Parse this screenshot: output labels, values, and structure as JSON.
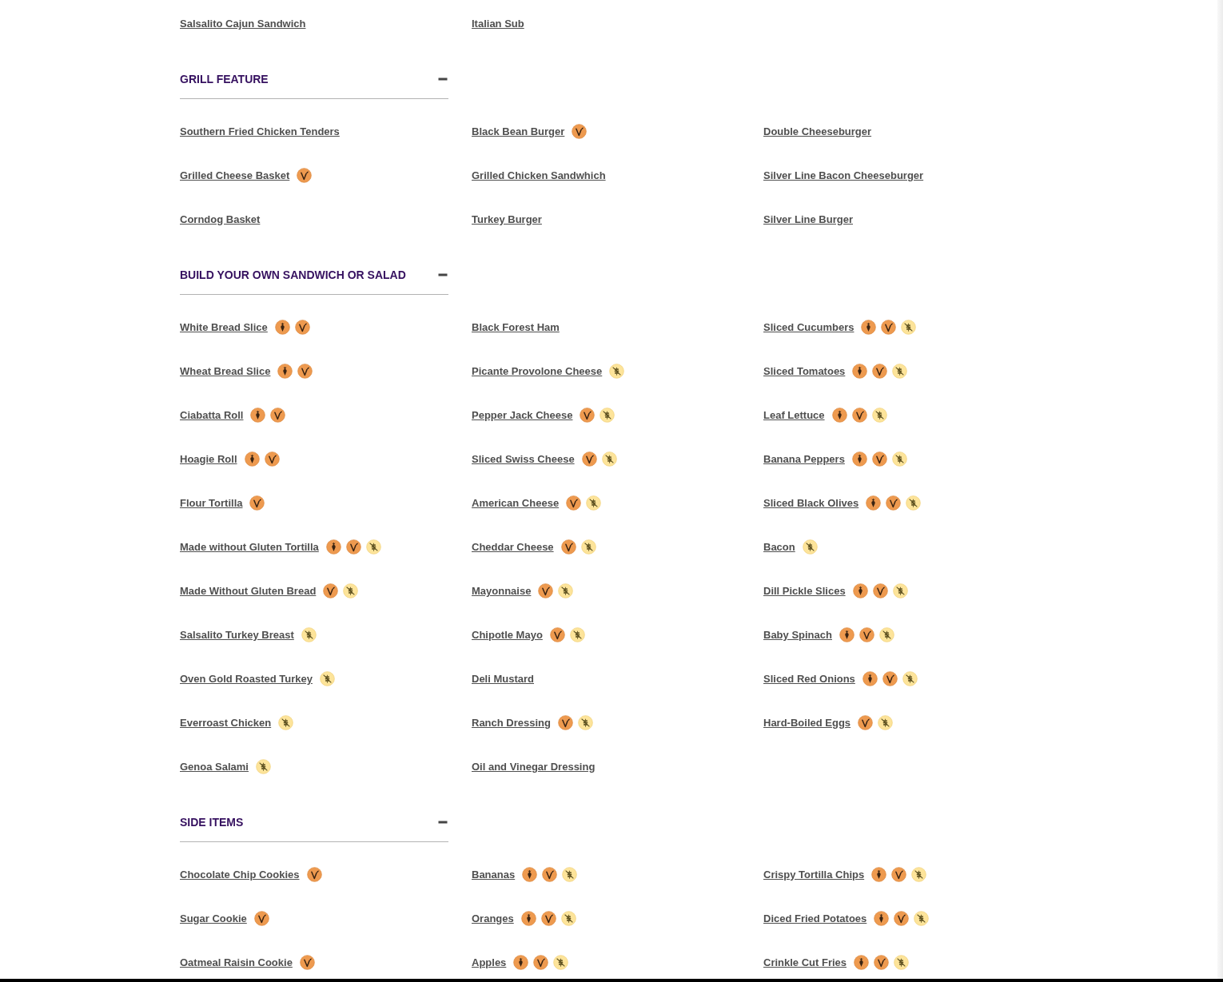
{
  "sections": [
    {
      "items": [
        {
          "name": "Salsalito Cajun Sandwich"
        },
        {
          "name": "Italian Sub"
        }
      ]
    },
    {
      "title": "GRILL FEATURE",
      "expanded": true,
      "items": [
        {
          "name": "Southern Fried Chicken Tenders"
        },
        {
          "name": "Grilled Cheese Basket",
          "icons": [
            {
              "kind": "vegetarian"
            }
          ]
        },
        {
          "name": "Corndog Basket"
        },
        {
          "name": "Black Bean Burger",
          "icons": [
            {
              "kind": "vegetarian"
            }
          ]
        },
        {
          "name": "Grilled Chicken Sandwhich"
        },
        {
          "name": "Turkey Burger"
        },
        {
          "name": "Double Cheeseburger"
        },
        {
          "name": "Silver Line Bacon Cheeseburger"
        },
        {
          "name": "Silver Line Burger"
        }
      ]
    },
    {
      "title": "BUILD YOUR OWN SANDWICH OR SALAD",
      "expanded": true,
      "items": [
        {
          "name": "White Bread Slice",
          "icons": [
            {
              "kind": "vegan"
            },
            {
              "kind": "vegetarian"
            }
          ]
        },
        {
          "name": "Wheat Bread Slice",
          "icons": [
            {
              "kind": "vegan"
            },
            {
              "kind": "vegetarian"
            }
          ]
        },
        {
          "name": "Ciabatta Roll",
          "icons": [
            {
              "kind": "vegan"
            },
            {
              "kind": "vegetarian"
            }
          ]
        },
        {
          "name": "Hoagie Roll",
          "icons": [
            {
              "kind": "vegan"
            },
            {
              "kind": "vegetarian"
            }
          ]
        },
        {
          "name": "Flour Tortilla",
          "icons": [
            {
              "kind": "vegetarian"
            }
          ]
        },
        {
          "name": "Made without Gluten Tortilla",
          "icons": [
            {
              "kind": "vegan"
            },
            {
              "kind": "vegetarian"
            },
            {
              "kind": "glutenfree"
            }
          ]
        },
        {
          "name": "Made Without Gluten Bread",
          "icons": [
            {
              "kind": "vegetarian"
            },
            {
              "kind": "glutenfree"
            }
          ]
        },
        {
          "name": "Salsalito Turkey Breast",
          "icons": [
            {
              "kind": "glutenfree"
            }
          ]
        },
        {
          "name": "Oven Gold Roasted Turkey",
          "icons": [
            {
              "kind": "glutenfree"
            }
          ]
        },
        {
          "name": "Everroast Chicken",
          "icons": [
            {
              "kind": "glutenfree"
            }
          ]
        },
        {
          "name": "Genoa Salami",
          "icons": [
            {
              "kind": "glutenfree"
            }
          ]
        },
        {
          "name": "Black Forest Ham"
        },
        {
          "name": "Picante Provolone Cheese",
          "icons": [
            {
              "kind": "glutenfree"
            }
          ]
        },
        {
          "name": "Pepper Jack Cheese",
          "icons": [
            {
              "kind": "vegetarian"
            },
            {
              "kind": "glutenfree"
            }
          ]
        },
        {
          "name": "Sliced Swiss Cheese",
          "icons": [
            {
              "kind": "vegetarian"
            },
            {
              "kind": "glutenfree"
            }
          ]
        },
        {
          "name": "American Cheese",
          "icons": [
            {
              "kind": "vegetarian"
            },
            {
              "kind": "glutenfree"
            }
          ]
        },
        {
          "name": "Cheddar Cheese",
          "icons": [
            {
              "kind": "vegetarian"
            },
            {
              "kind": "glutenfree"
            }
          ]
        },
        {
          "name": "Mayonnaise",
          "icons": [
            {
              "kind": "vegetarian"
            },
            {
              "kind": "glutenfree"
            }
          ]
        },
        {
          "name": "Chipotle Mayo",
          "icons": [
            {
              "kind": "vegetarian"
            },
            {
              "kind": "glutenfree"
            }
          ]
        },
        {
          "name": "Deli Mustard"
        },
        {
          "name": "Ranch Dressing",
          "icons": [
            {
              "kind": "vegetarian"
            },
            {
              "kind": "glutenfree"
            }
          ]
        },
        {
          "name": "Oil and Vinegar Dressing"
        },
        {
          "name": "Sliced Cucumbers",
          "icons": [
            {
              "kind": "vegan"
            },
            {
              "kind": "vegetarian"
            },
            {
              "kind": "glutenfree"
            }
          ]
        },
        {
          "name": "Sliced Tomatoes",
          "icons": [
            {
              "kind": "vegan"
            },
            {
              "kind": "vegetarian"
            },
            {
              "kind": "glutenfree"
            }
          ]
        },
        {
          "name": "Leaf Lettuce",
          "icons": [
            {
              "kind": "vegan"
            },
            {
              "kind": "vegetarian"
            },
            {
              "kind": "glutenfree"
            }
          ]
        },
        {
          "name": "Banana Peppers",
          "icons": [
            {
              "kind": "vegan"
            },
            {
              "kind": "vegetarian"
            },
            {
              "kind": "glutenfree"
            }
          ]
        },
        {
          "name": "Sliced Black Olives",
          "icons": [
            {
              "kind": "vegan"
            },
            {
              "kind": "vegetarian"
            },
            {
              "kind": "glutenfree"
            }
          ]
        },
        {
          "name": "Bacon",
          "icons": [
            {
              "kind": "glutenfree"
            }
          ]
        },
        {
          "name": "Dill Pickle Slices",
          "icons": [
            {
              "kind": "vegan"
            },
            {
              "kind": "vegetarian"
            },
            {
              "kind": "glutenfree"
            }
          ]
        },
        {
          "name": "Baby Spinach",
          "icons": [
            {
              "kind": "vegan"
            },
            {
              "kind": "vegetarian"
            },
            {
              "kind": "glutenfree"
            }
          ]
        },
        {
          "name": "Sliced Red Onions",
          "icons": [
            {
              "kind": "vegan"
            },
            {
              "kind": "vegetarian"
            },
            {
              "kind": "glutenfree"
            }
          ]
        },
        {
          "name": "Hard-Boiled Eggs",
          "icons": [
            {
              "kind": "vegetarian"
            },
            {
              "kind": "glutenfree"
            }
          ]
        }
      ]
    },
    {
      "title": "SIDE ITEMS",
      "expanded": true,
      "items": [
        {
          "name": "Chocolate Chip Cookies",
          "icons": [
            {
              "kind": "vegetarian"
            }
          ]
        },
        {
          "name": "Sugar Cookie",
          "icons": [
            {
              "kind": "vegetarian"
            }
          ]
        },
        {
          "name": "Oatmeal Raisin Cookie",
          "icons": [
            {
              "kind": "vegetarian"
            }
          ]
        },
        {
          "name": "Bananas",
          "icons": [
            {
              "kind": "vegan"
            },
            {
              "kind": "vegetarian"
            },
            {
              "kind": "glutenfree"
            }
          ]
        },
        {
          "name": "Oranges",
          "icons": [
            {
              "kind": "vegan"
            },
            {
              "kind": "vegetarian"
            },
            {
              "kind": "glutenfree"
            }
          ]
        },
        {
          "name": "Apples",
          "icons": [
            {
              "kind": "vegan"
            },
            {
              "kind": "vegetarian"
            },
            {
              "kind": "glutenfree"
            }
          ]
        },
        {
          "name": "Crispy Tortilla Chips",
          "icons": [
            {
              "kind": "vegan"
            },
            {
              "kind": "vegetarian"
            },
            {
              "kind": "glutenfree"
            }
          ]
        },
        {
          "name": "Diced Fried Potatoes",
          "icons": [
            {
              "kind": "vegan"
            },
            {
              "kind": "vegetarian"
            },
            {
              "kind": "glutenfree"
            }
          ]
        },
        {
          "name": "Crinkle Cut Fries",
          "icons": [
            {
              "kind": "vegan"
            },
            {
              "kind": "vegetarian"
            },
            {
              "kind": "glutenfree"
            }
          ]
        }
      ]
    }
  ]
}
